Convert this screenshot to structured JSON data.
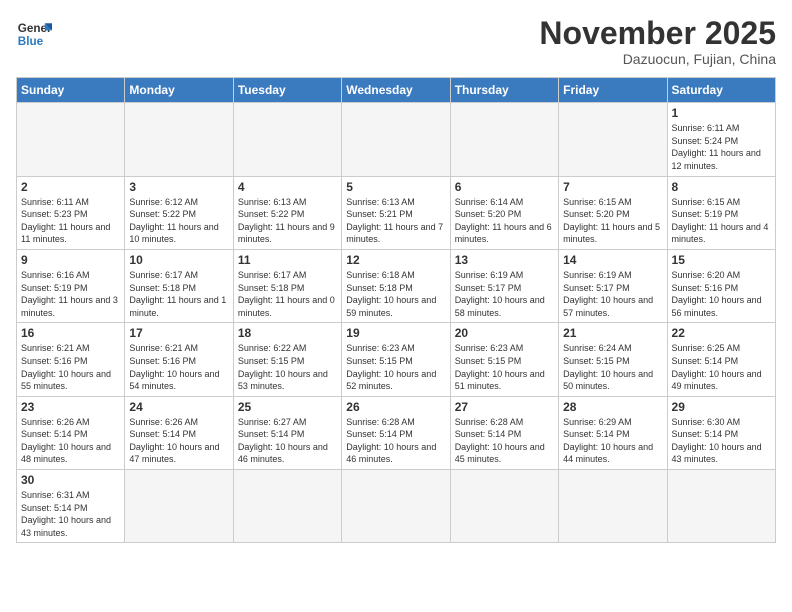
{
  "header": {
    "logo_general": "General",
    "logo_blue": "Blue",
    "month_title": "November 2025",
    "location": "Dazuocun, Fujian, China"
  },
  "days_of_week": [
    "Sunday",
    "Monday",
    "Tuesday",
    "Wednesday",
    "Thursday",
    "Friday",
    "Saturday"
  ],
  "weeks": [
    [
      {
        "day": "",
        "info": ""
      },
      {
        "day": "",
        "info": ""
      },
      {
        "day": "",
        "info": ""
      },
      {
        "day": "",
        "info": ""
      },
      {
        "day": "",
        "info": ""
      },
      {
        "day": "",
        "info": ""
      },
      {
        "day": "1",
        "info": "Sunrise: 6:11 AM\nSunset: 5:24 PM\nDaylight: 11 hours and 12 minutes."
      }
    ],
    [
      {
        "day": "2",
        "info": "Sunrise: 6:11 AM\nSunset: 5:23 PM\nDaylight: 11 hours and 11 minutes."
      },
      {
        "day": "3",
        "info": "Sunrise: 6:12 AM\nSunset: 5:22 PM\nDaylight: 11 hours and 10 minutes."
      },
      {
        "day": "4",
        "info": "Sunrise: 6:13 AM\nSunset: 5:22 PM\nDaylight: 11 hours and 9 minutes."
      },
      {
        "day": "5",
        "info": "Sunrise: 6:13 AM\nSunset: 5:21 PM\nDaylight: 11 hours and 7 minutes."
      },
      {
        "day": "6",
        "info": "Sunrise: 6:14 AM\nSunset: 5:20 PM\nDaylight: 11 hours and 6 minutes."
      },
      {
        "day": "7",
        "info": "Sunrise: 6:15 AM\nSunset: 5:20 PM\nDaylight: 11 hours and 5 minutes."
      },
      {
        "day": "8",
        "info": "Sunrise: 6:15 AM\nSunset: 5:19 PM\nDaylight: 11 hours and 4 minutes."
      }
    ],
    [
      {
        "day": "9",
        "info": "Sunrise: 6:16 AM\nSunset: 5:19 PM\nDaylight: 11 hours and 3 minutes."
      },
      {
        "day": "10",
        "info": "Sunrise: 6:17 AM\nSunset: 5:18 PM\nDaylight: 11 hours and 1 minute."
      },
      {
        "day": "11",
        "info": "Sunrise: 6:17 AM\nSunset: 5:18 PM\nDaylight: 11 hours and 0 minutes."
      },
      {
        "day": "12",
        "info": "Sunrise: 6:18 AM\nSunset: 5:18 PM\nDaylight: 10 hours and 59 minutes."
      },
      {
        "day": "13",
        "info": "Sunrise: 6:19 AM\nSunset: 5:17 PM\nDaylight: 10 hours and 58 minutes."
      },
      {
        "day": "14",
        "info": "Sunrise: 6:19 AM\nSunset: 5:17 PM\nDaylight: 10 hours and 57 minutes."
      },
      {
        "day": "15",
        "info": "Sunrise: 6:20 AM\nSunset: 5:16 PM\nDaylight: 10 hours and 56 minutes."
      }
    ],
    [
      {
        "day": "16",
        "info": "Sunrise: 6:21 AM\nSunset: 5:16 PM\nDaylight: 10 hours and 55 minutes."
      },
      {
        "day": "17",
        "info": "Sunrise: 6:21 AM\nSunset: 5:16 PM\nDaylight: 10 hours and 54 minutes."
      },
      {
        "day": "18",
        "info": "Sunrise: 6:22 AM\nSunset: 5:15 PM\nDaylight: 10 hours and 53 minutes."
      },
      {
        "day": "19",
        "info": "Sunrise: 6:23 AM\nSunset: 5:15 PM\nDaylight: 10 hours and 52 minutes."
      },
      {
        "day": "20",
        "info": "Sunrise: 6:23 AM\nSunset: 5:15 PM\nDaylight: 10 hours and 51 minutes."
      },
      {
        "day": "21",
        "info": "Sunrise: 6:24 AM\nSunset: 5:15 PM\nDaylight: 10 hours and 50 minutes."
      },
      {
        "day": "22",
        "info": "Sunrise: 6:25 AM\nSunset: 5:14 PM\nDaylight: 10 hours and 49 minutes."
      }
    ],
    [
      {
        "day": "23",
        "info": "Sunrise: 6:26 AM\nSunset: 5:14 PM\nDaylight: 10 hours and 48 minutes."
      },
      {
        "day": "24",
        "info": "Sunrise: 6:26 AM\nSunset: 5:14 PM\nDaylight: 10 hours and 47 minutes."
      },
      {
        "day": "25",
        "info": "Sunrise: 6:27 AM\nSunset: 5:14 PM\nDaylight: 10 hours and 46 minutes."
      },
      {
        "day": "26",
        "info": "Sunrise: 6:28 AM\nSunset: 5:14 PM\nDaylight: 10 hours and 46 minutes."
      },
      {
        "day": "27",
        "info": "Sunrise: 6:28 AM\nSunset: 5:14 PM\nDaylight: 10 hours and 45 minutes."
      },
      {
        "day": "28",
        "info": "Sunrise: 6:29 AM\nSunset: 5:14 PM\nDaylight: 10 hours and 44 minutes."
      },
      {
        "day": "29",
        "info": "Sunrise: 6:30 AM\nSunset: 5:14 PM\nDaylight: 10 hours and 43 minutes."
      }
    ],
    [
      {
        "day": "30",
        "info": "Sunrise: 6:31 AM\nSunset: 5:14 PM\nDaylight: 10 hours and 43 minutes."
      },
      {
        "day": "",
        "info": ""
      },
      {
        "day": "",
        "info": ""
      },
      {
        "day": "",
        "info": ""
      },
      {
        "day": "",
        "info": ""
      },
      {
        "day": "",
        "info": ""
      },
      {
        "day": "",
        "info": ""
      }
    ]
  ]
}
